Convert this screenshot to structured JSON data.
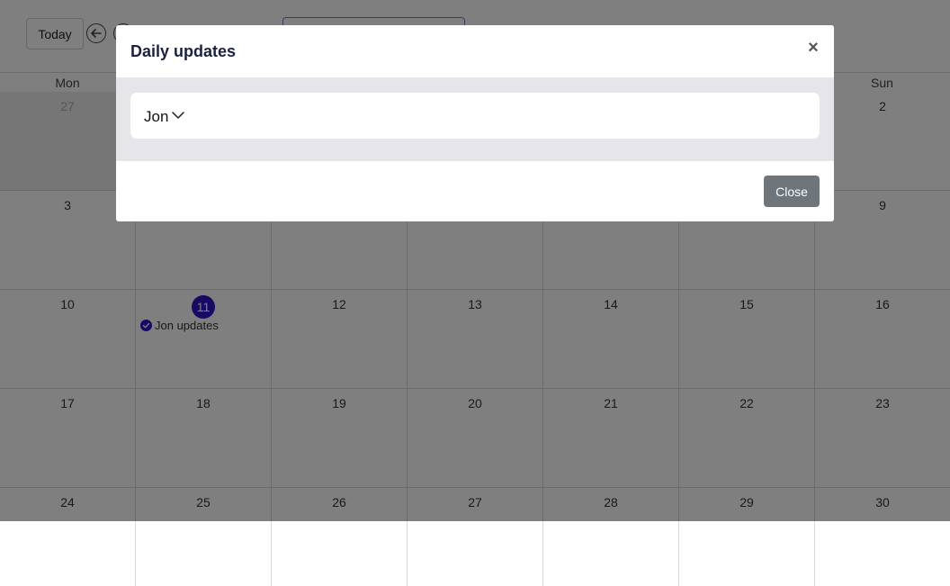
{
  "toolbar": {
    "today_label": "Today"
  },
  "calendar": {
    "weekday_visible": {
      "first": "Mon",
      "last": "Sun"
    },
    "weeks": [
      {
        "days": [
          "27",
          "",
          "",
          "",
          "",
          "",
          "2"
        ],
        "outside": [
          true,
          true,
          true,
          true,
          true,
          true,
          false
        ]
      },
      {
        "days": [
          "3",
          "",
          "",
          "",
          "",
          "",
          "9"
        ],
        "outside": [
          false,
          false,
          false,
          false,
          false,
          false,
          false
        ]
      },
      {
        "days": [
          "10",
          "11",
          "12",
          "13",
          "14",
          "15",
          "16"
        ],
        "outside": [
          false,
          false,
          false,
          false,
          false,
          false,
          false
        ]
      },
      {
        "days": [
          "17",
          "18",
          "19",
          "20",
          "21",
          "22",
          "23"
        ],
        "outside": [
          false,
          false,
          false,
          false,
          false,
          false,
          false
        ]
      },
      {
        "days": [
          "24",
          "25",
          "26",
          "27",
          "28",
          "29",
          "30"
        ],
        "outside": [
          false,
          false,
          false,
          false,
          false,
          false,
          false
        ]
      }
    ],
    "today": "11",
    "event": {
      "label": "Jon updates"
    }
  },
  "modal": {
    "title": "Daily updates",
    "close_glyph": "×",
    "selected_user": "Jon",
    "close_button_label": "Close"
  },
  "colors": {
    "accent": "#2c15c8",
    "close_button": "#6e757b",
    "modal_body_bg": "#e6e6ea"
  }
}
